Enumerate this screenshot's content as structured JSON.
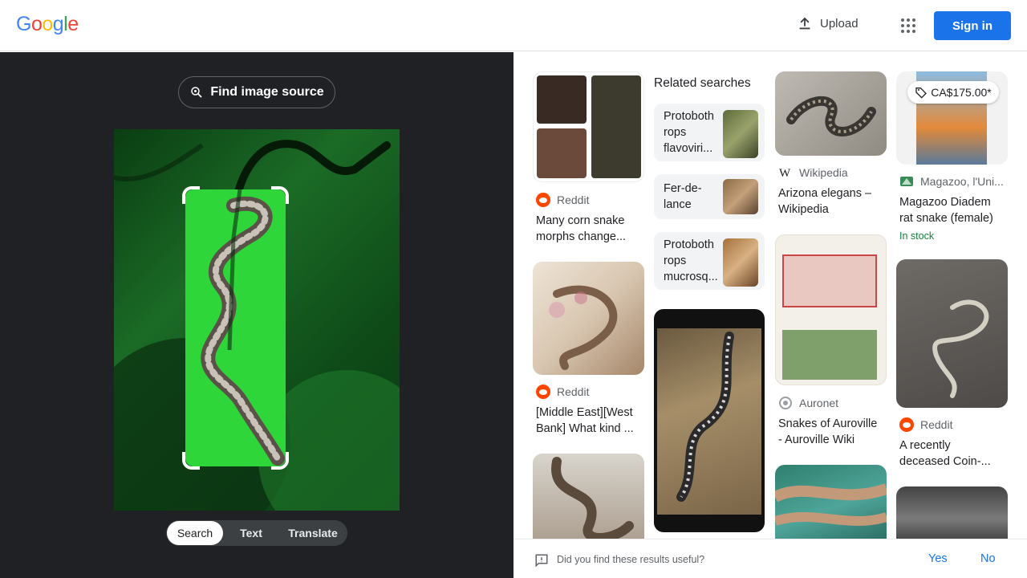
{
  "header": {
    "logo_letters": [
      "G",
      "o",
      "o",
      "g",
      "l",
      "e"
    ],
    "logo_colors": [
      "#4285f4",
      "#ea4335",
      "#fbbc05",
      "#4285f4",
      "#34a853",
      "#ea4335"
    ],
    "upload_label": "Upload",
    "signin_label": "Sign in"
  },
  "left": {
    "find_source_label": "Find image source",
    "tabs": [
      {
        "label": "Search",
        "active": true
      },
      {
        "label": "Text",
        "active": false
      },
      {
        "label": "Translate",
        "active": false
      }
    ]
  },
  "results": {
    "col1": [
      {
        "source": "Reddit",
        "caption_lines": [
          "Many corn snake",
          "morphs change..."
        ]
      },
      {
        "source": "Reddit",
        "caption_lines": [
          "[Middle East][West",
          "Bank] What kind ..."
        ]
      }
    ],
    "related": {
      "title": "Related searches",
      "items": [
        {
          "lines": [
            "Protoboth",
            "rops",
            "flavoviri..."
          ]
        },
        {
          "lines": [
            "Fer-de-",
            "lance"
          ]
        },
        {
          "lines": [
            "Protoboth",
            "rops",
            "mucrosq..."
          ]
        }
      ]
    },
    "col3": [
      {
        "source": "Wikipedia",
        "caption_lines": [
          "Arizona elegans –",
          "Wikipedia"
        ]
      },
      {
        "source": "Auronet",
        "caption_lines": [
          "Snakes of Auroville",
          "- Auroville Wiki"
        ]
      }
    ],
    "col4": [
      {
        "price": "CA$175.00*",
        "source": "Magazoo, l'Uni...",
        "caption_lines": [
          "Magazoo Diadem",
          "rat snake (female)"
        ],
        "stock": "In stock"
      },
      {
        "source": "Reddit",
        "caption_lines": [
          "A recently",
          "deceased Coin-..."
        ]
      }
    ]
  },
  "feedback": {
    "question": "Did you find these results useful?",
    "yes": "Yes",
    "no": "No"
  },
  "colors": {
    "accent": "#1a73e8",
    "left_bg": "#202124",
    "reddit": "#ff4500",
    "in_stock": "#188038"
  }
}
